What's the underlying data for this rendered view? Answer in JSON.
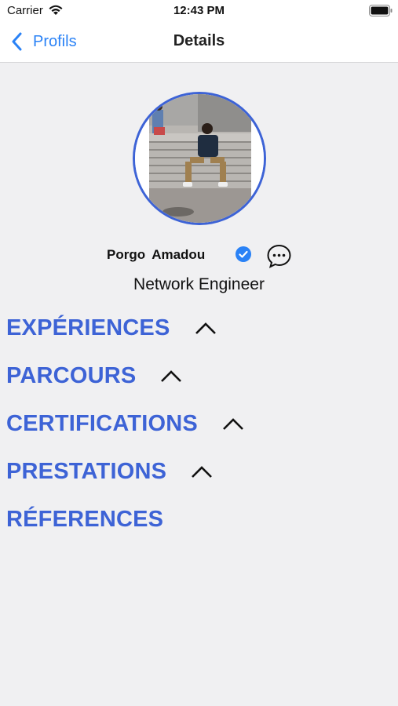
{
  "status_bar": {
    "carrier": "Carrier",
    "time": "12:43 PM"
  },
  "nav": {
    "back_label": "Profils",
    "title": "Details"
  },
  "profile": {
    "name": "Porgo Amadou",
    "role": "Network Engineer"
  },
  "sections": [
    {
      "label": "EXPÉRIENCES",
      "expandable": true
    },
    {
      "label": "PARCOURS",
      "expandable": true
    },
    {
      "label": "CERTIFICATIONS",
      "expandable": true
    },
    {
      "label": "PRESTATIONS",
      "expandable": true
    },
    {
      "label": "RÉFERENCES",
      "expandable": false
    }
  ],
  "colors": {
    "accent": "#3d63d6",
    "ios_blue": "#2a82f6",
    "background": "#f0f0f2"
  }
}
